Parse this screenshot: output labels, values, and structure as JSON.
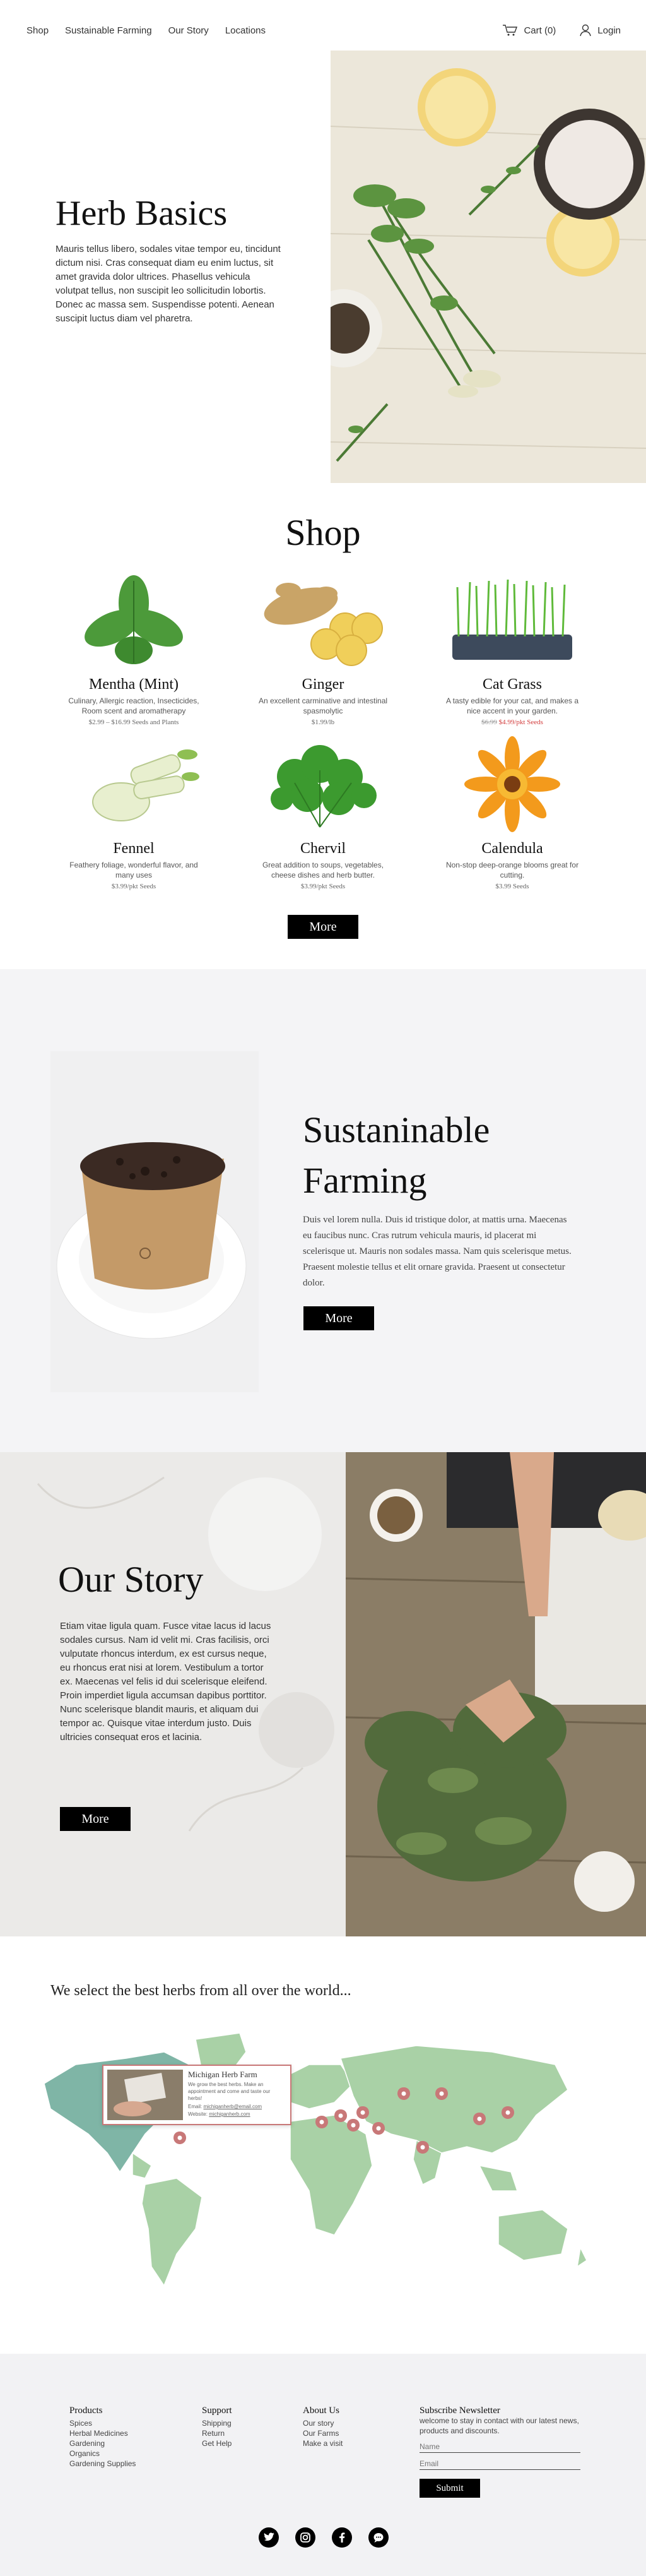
{
  "nav": {
    "items": [
      "Shop",
      "Sustainable Farming",
      "Our Story",
      "Locations"
    ],
    "cart": "Cart (0)",
    "login": "Login"
  },
  "hero": {
    "title": "Herb Basics",
    "text": "Mauris tellus libero, sodales vitae tempor eu, tincidunt dictum nisi. Cras consequat diam eu enim luctus, sit amet gravida dolor ultrices. Phasellus vehicula volutpat tellus, non suscipit leo sollicitudin lobortis. Donec ac massa sem. Suspendisse potenti. Aenean suscipit luctus diam vel pharetra."
  },
  "shop": {
    "title": "Shop",
    "more": "More",
    "products": [
      {
        "name": "Mentha (Mint)",
        "desc": "Culinary, Allergic reaction, Insecticides, Room scent and aromatherapy",
        "price": "$2.99 – $16.99 Seeds and Plants",
        "old_price": ""
      },
      {
        "name": "Ginger",
        "desc": "An excellent carminative and intestinal spasmolytic",
        "price": "$1.99/lb",
        "old_price": ""
      },
      {
        "name": "Cat Grass",
        "desc": "A tasty edible for your cat, and makes a nice accent in your garden.",
        "price": "$4.99/pkt Seeds",
        "old_price": "$6.99"
      },
      {
        "name": "Fennel",
        "desc": "Feathery foliage, wonderful flavor, and many uses",
        "price": "$3.99/pkt Seeds",
        "old_price": ""
      },
      {
        "name": "Chervil",
        "desc": "Great addition to soups, vegetables, cheese dishes and herb butter.",
        "price": "$3.99/pkt Seeds",
        "old_price": ""
      },
      {
        "name": "Calendula",
        "desc": "Non-stop deep-orange blooms great for cutting.",
        "price": "$3.99 Seeds",
        "old_price": ""
      }
    ]
  },
  "sustain": {
    "title_line1": "Sustaninable",
    "title_line2": "Farming",
    "text": "Duis vel lorem nulla. Duis id tristique dolor, at mattis urna. Maecenas eu faucibus nunc. Cras rutrum vehicula mauris, id placerat mi scelerisque ut. Mauris non sodales massa. Nam quis scelerisque metus. Praesent molestie tellus et elit ornare gravida. Praesent ut consectetur dolor.",
    "more": "More"
  },
  "story": {
    "title": "Our Story",
    "text": "Etiam vitae ligula quam. Fusce vitae lacus id lacus sodales cursus. Nam id velit mi. Cras facilisis, orci vulputate rhoncus interdum, ex est cursus neque, eu rhoncus erat nisi at lorem. Vestibulum a tortor ex. Maecenas vel felis id dui scelerisque eleifend. Proin imperdiet ligula accumsan dapibus porttitor. Nunc scelerisque blandit mauris, et aliquam dui tempor ac. Quisque vitae interdum justo. Duis ultricies consequat eros et lacinia.",
    "more": "More"
  },
  "world": {
    "title": "We select the best herbs from all over the world...",
    "popup": {
      "title": "Michigan Herb Farm",
      "text": "We grow the best herbs. Make an appointment and come and taste our herbs!",
      "email_label": "Email:",
      "email": "michiganherb@email.com",
      "website_label": "Website:",
      "website": "michiganherb.com"
    }
  },
  "footer": {
    "products": {
      "title": "Products",
      "links": [
        "Spices",
        "Herbal Medicines",
        "Gardening",
        "Organics",
        "Gardening Supplies"
      ]
    },
    "support": {
      "title": "Support",
      "links": [
        "Shipping",
        "Return",
        "Get Help"
      ]
    },
    "about": {
      "title": "About Us",
      "links": [
        "Our story",
        "Our Farms",
        "Make a visit"
      ]
    },
    "subscribe": {
      "title": "Subscribe Newsletter",
      "text": "welcome to stay in contact with our latest news, products and discounts.",
      "name_placeholder": "Name",
      "email_placeholder": "Email",
      "submit": "Submit"
    }
  },
  "colors": {
    "accent": "#000000",
    "sale": "#d23c3c",
    "map_land": "#a8d1a6",
    "map_highlight": "#7fb5a6",
    "pin": "#c87878"
  }
}
